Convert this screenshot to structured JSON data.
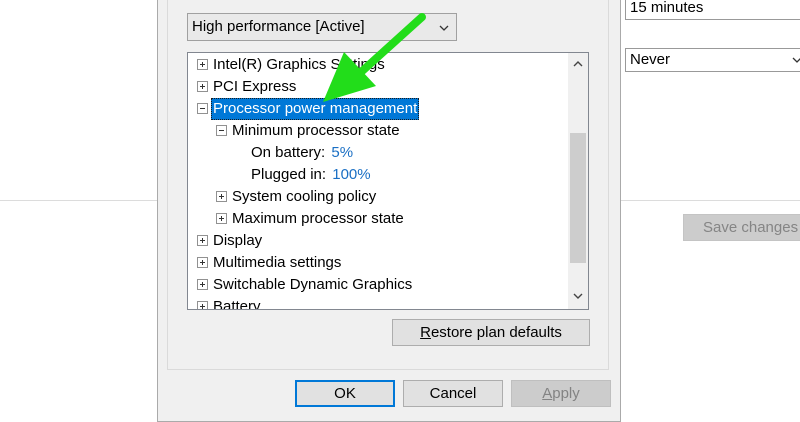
{
  "background": {
    "sleep_select_value": "15 minutes",
    "second_select_value": "Never",
    "save_changes_label": "Save changes"
  },
  "dialog": {
    "plan_select_value": "High performance [Active]",
    "tree": [
      {
        "label": "Intel(R) Graphics Settings",
        "expander": "plus"
      },
      {
        "label": "PCI Express",
        "expander": "plus"
      },
      {
        "label": "Processor power management",
        "expander": "minus",
        "selected": true
      },
      {
        "label": "Minimum processor state",
        "expander": "minus"
      },
      {
        "label": "On battery:",
        "value": "5%"
      },
      {
        "label": "Plugged in:",
        "value": "100%"
      },
      {
        "label": "System cooling policy",
        "expander": "plus"
      },
      {
        "label": "Maximum processor state",
        "expander": "plus"
      },
      {
        "label": "Display",
        "expander": "plus"
      },
      {
        "label": "Multimedia settings",
        "expander": "plus"
      },
      {
        "label": "Switchable Dynamic Graphics",
        "expander": "plus"
      },
      {
        "label": "Battery",
        "expander": "plus"
      }
    ],
    "restore_label": "Restore plan defaults",
    "restore_mnemonic": "R",
    "restore_rest": "estore plan defaults",
    "ok_label": "OK",
    "cancel_label": "Cancel",
    "apply_label": "Apply",
    "apply_mnemonic": "A",
    "apply_rest": "pply"
  },
  "annotation": {
    "arrow_color": "#22dd1a"
  },
  "icons": {
    "dropdown": "chevron-down-icon",
    "scroll_up": "chevron-up-icon",
    "scroll_down": "chevron-down-icon",
    "expand": "plus-box-icon",
    "collapse": "minus-box-icon"
  }
}
